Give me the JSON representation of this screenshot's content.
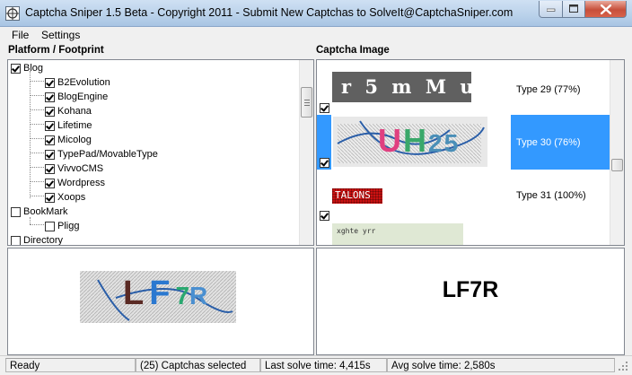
{
  "window": {
    "title": "Captcha Sniper 1.5 Beta - Copyright 2011 - Submit New Captchas to SolveIt@CaptchaSniper.com"
  },
  "menu": [
    "File",
    "Settings"
  ],
  "headers": {
    "left": "Platform / Footprint",
    "right": "Captcha Image"
  },
  "tree": [
    {
      "label": "Blog",
      "checked": true,
      "level": 0
    },
    {
      "label": "B2Evolution",
      "checked": true,
      "level": 1
    },
    {
      "label": "BlogEngine",
      "checked": true,
      "level": 1
    },
    {
      "label": "Kohana",
      "checked": true,
      "level": 1
    },
    {
      "label": "Lifetime",
      "checked": true,
      "level": 1
    },
    {
      "label": "Micolog",
      "checked": true,
      "level": 1
    },
    {
      "label": "TypePad/MovableType",
      "checked": true,
      "level": 1
    },
    {
      "label": "VivvoCMS",
      "checked": true,
      "level": 1
    },
    {
      "label": "Wordpress",
      "checked": true,
      "level": 1
    },
    {
      "label": "Xoops",
      "checked": true,
      "level": 1
    },
    {
      "label": "BookMark",
      "checked": false,
      "level": 0
    },
    {
      "label": "Pligg",
      "checked": false,
      "level": 1
    },
    {
      "label": "Directory",
      "checked": false,
      "level": 0
    }
  ],
  "captchas": [
    {
      "image_text": "r 5 m M u P",
      "type": "Type 29 (77%)",
      "checked": true,
      "selected": false
    },
    {
      "image_text": "UH25",
      "type": "Type 30 (76%)",
      "checked": true,
      "selected": true
    },
    {
      "image_text": "TALONS",
      "type": "Type 31 (100%)",
      "checked": true,
      "selected": false
    },
    {
      "image_text": "xghte yrr",
      "type": "",
      "checked": false,
      "selected": false
    }
  ],
  "preview": {
    "image_text": "LF7R"
  },
  "answer": "LF7R",
  "status": {
    "state": "Ready",
    "selected": "(25) Captchas selected",
    "last_solve": "Last solve time: 4,415s",
    "avg_solve": "Avg solve time: 2,580s"
  },
  "colors": {
    "selection": "#3399ff",
    "captcha1_bg": "#606060",
    "captcha3_bg": "#cc1111"
  }
}
